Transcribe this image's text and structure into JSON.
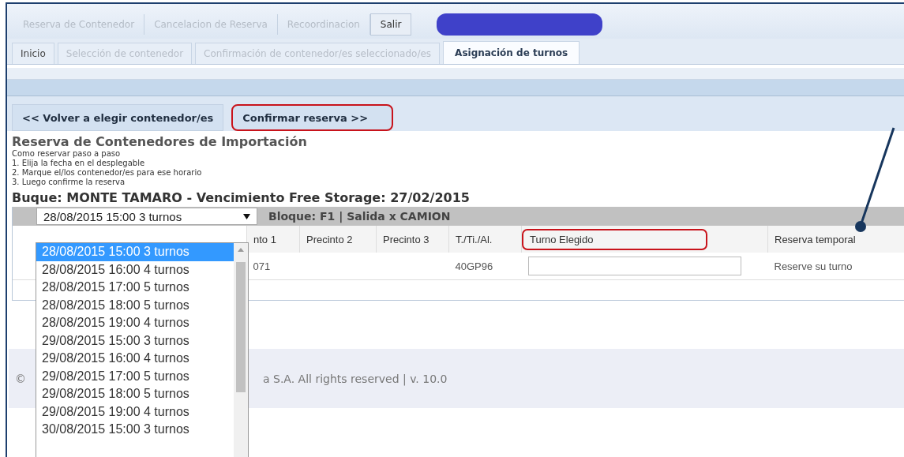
{
  "top_menu": [
    {
      "label": "Reserva de Contenedor",
      "disabled": true
    },
    {
      "label": "Cancelacion de Reserva",
      "disabled": true
    },
    {
      "label": "Recoordinacion",
      "disabled": true
    },
    {
      "label": "Salir",
      "disabled": false
    }
  ],
  "tabs": [
    {
      "label": "Inicio",
      "selected": false,
      "disabled": false
    },
    {
      "label": "Selección de contenedor",
      "selected": false,
      "disabled": true
    },
    {
      "label": "Confirmación de contenedor/es seleccionado/es",
      "selected": false,
      "disabled": true
    },
    {
      "label": "Asignación de turnos",
      "selected": true,
      "disabled": false
    }
  ],
  "actions": [
    {
      "label": "<< Volver a elegir contenedor/es",
      "highlighted": false
    },
    {
      "label": "Confirmar reserva >>",
      "highlighted": true
    }
  ],
  "heading": "Reserva de Contenedores de Importación",
  "instructions": [
    "Como reservar paso a paso",
    "1. Elija la fecha en el desplegable",
    "2. Marque el/los contenedor/es para ese horario",
    "3. Luego confirme la reserva"
  ],
  "vessel_line": "Buque: MONTE TAMARO - Vencimiento Free Storage: 27/02/2015",
  "date_select": {
    "value": "28/08/2015 15:00 3 turnos",
    "expanded": true,
    "options": [
      {
        "label": "28/08/2015 15:00 3 turnos",
        "selected": true
      },
      {
        "label": "28/08/2015 16:00 4 turnos",
        "selected": false
      },
      {
        "label": "28/08/2015 17:00 5 turnos",
        "selected": false
      },
      {
        "label": "28/08/2015 18:00 5 turnos",
        "selected": false
      },
      {
        "label": "28/08/2015 19:00 4 turnos",
        "selected": false
      },
      {
        "label": "29/08/2015 15:00 3 turnos",
        "selected": false
      },
      {
        "label": "29/08/2015 16:00 4 turnos",
        "selected": false
      },
      {
        "label": "29/08/2015 17:00 5 turnos",
        "selected": false
      },
      {
        "label": "29/08/2015 18:00 5 turnos",
        "selected": false
      },
      {
        "label": "29/08/2015 19:00 4 turnos",
        "selected": false
      },
      {
        "label": "30/08/2015 15:00 3 turnos",
        "selected": false
      }
    ]
  },
  "block_info": "Bloque: F1 | Salida x CAMION",
  "table": {
    "columns": [
      {
        "label": "nto 1",
        "highlighted": false
      },
      {
        "label": "Precinto 2",
        "highlighted": false
      },
      {
        "label": "Precinto 3",
        "highlighted": false
      },
      {
        "label": "T./Ti./Al.",
        "highlighted": false
      },
      {
        "label": "Turno Elegido",
        "highlighted": true
      },
      {
        "label": "Reserva temporal",
        "highlighted": false
      }
    ],
    "rows": [
      {
        "column_1": "071",
        "t_ti_al": "40GP96",
        "reserva_temporal": "Reserve su turno"
      }
    ]
  },
  "footer": {
    "mark": "©",
    "text": "a S.A. All rights reserved | v. 10.0"
  }
}
